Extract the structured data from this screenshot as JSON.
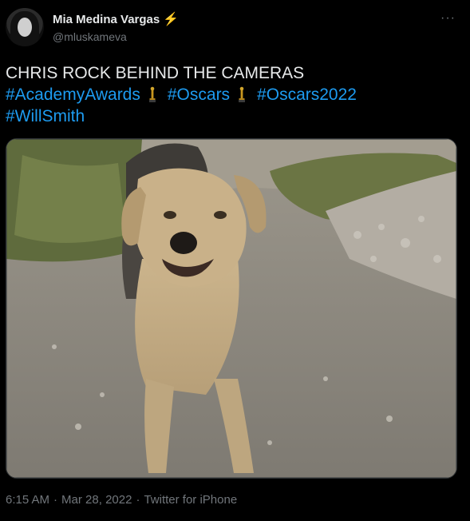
{
  "author": {
    "display_name": "Mia Medina Vargas",
    "verified_icon": "lightning-bolt-icon",
    "handle": "@mluskameva"
  },
  "tweet": {
    "line1": "CHRIS ROCK BEHIND THE CAMERAS",
    "hashtags": [
      "#AcademyAwards",
      "#Oscars",
      "#Oscars2022",
      "#WillSmith"
    ],
    "trophy_icon": "oscar-trophy-icon"
  },
  "media": {
    "type": "photo",
    "subject": "dog-photo"
  },
  "meta": {
    "time": "6:15 AM",
    "separator": "·",
    "date": "Mar 28, 2022",
    "source": "Twitter for iPhone"
  },
  "colors": {
    "background": "#000000",
    "text": "#e7e9ea",
    "link": "#1d9bf0",
    "secondary": "#71767b",
    "bolt": "#f4b400"
  }
}
